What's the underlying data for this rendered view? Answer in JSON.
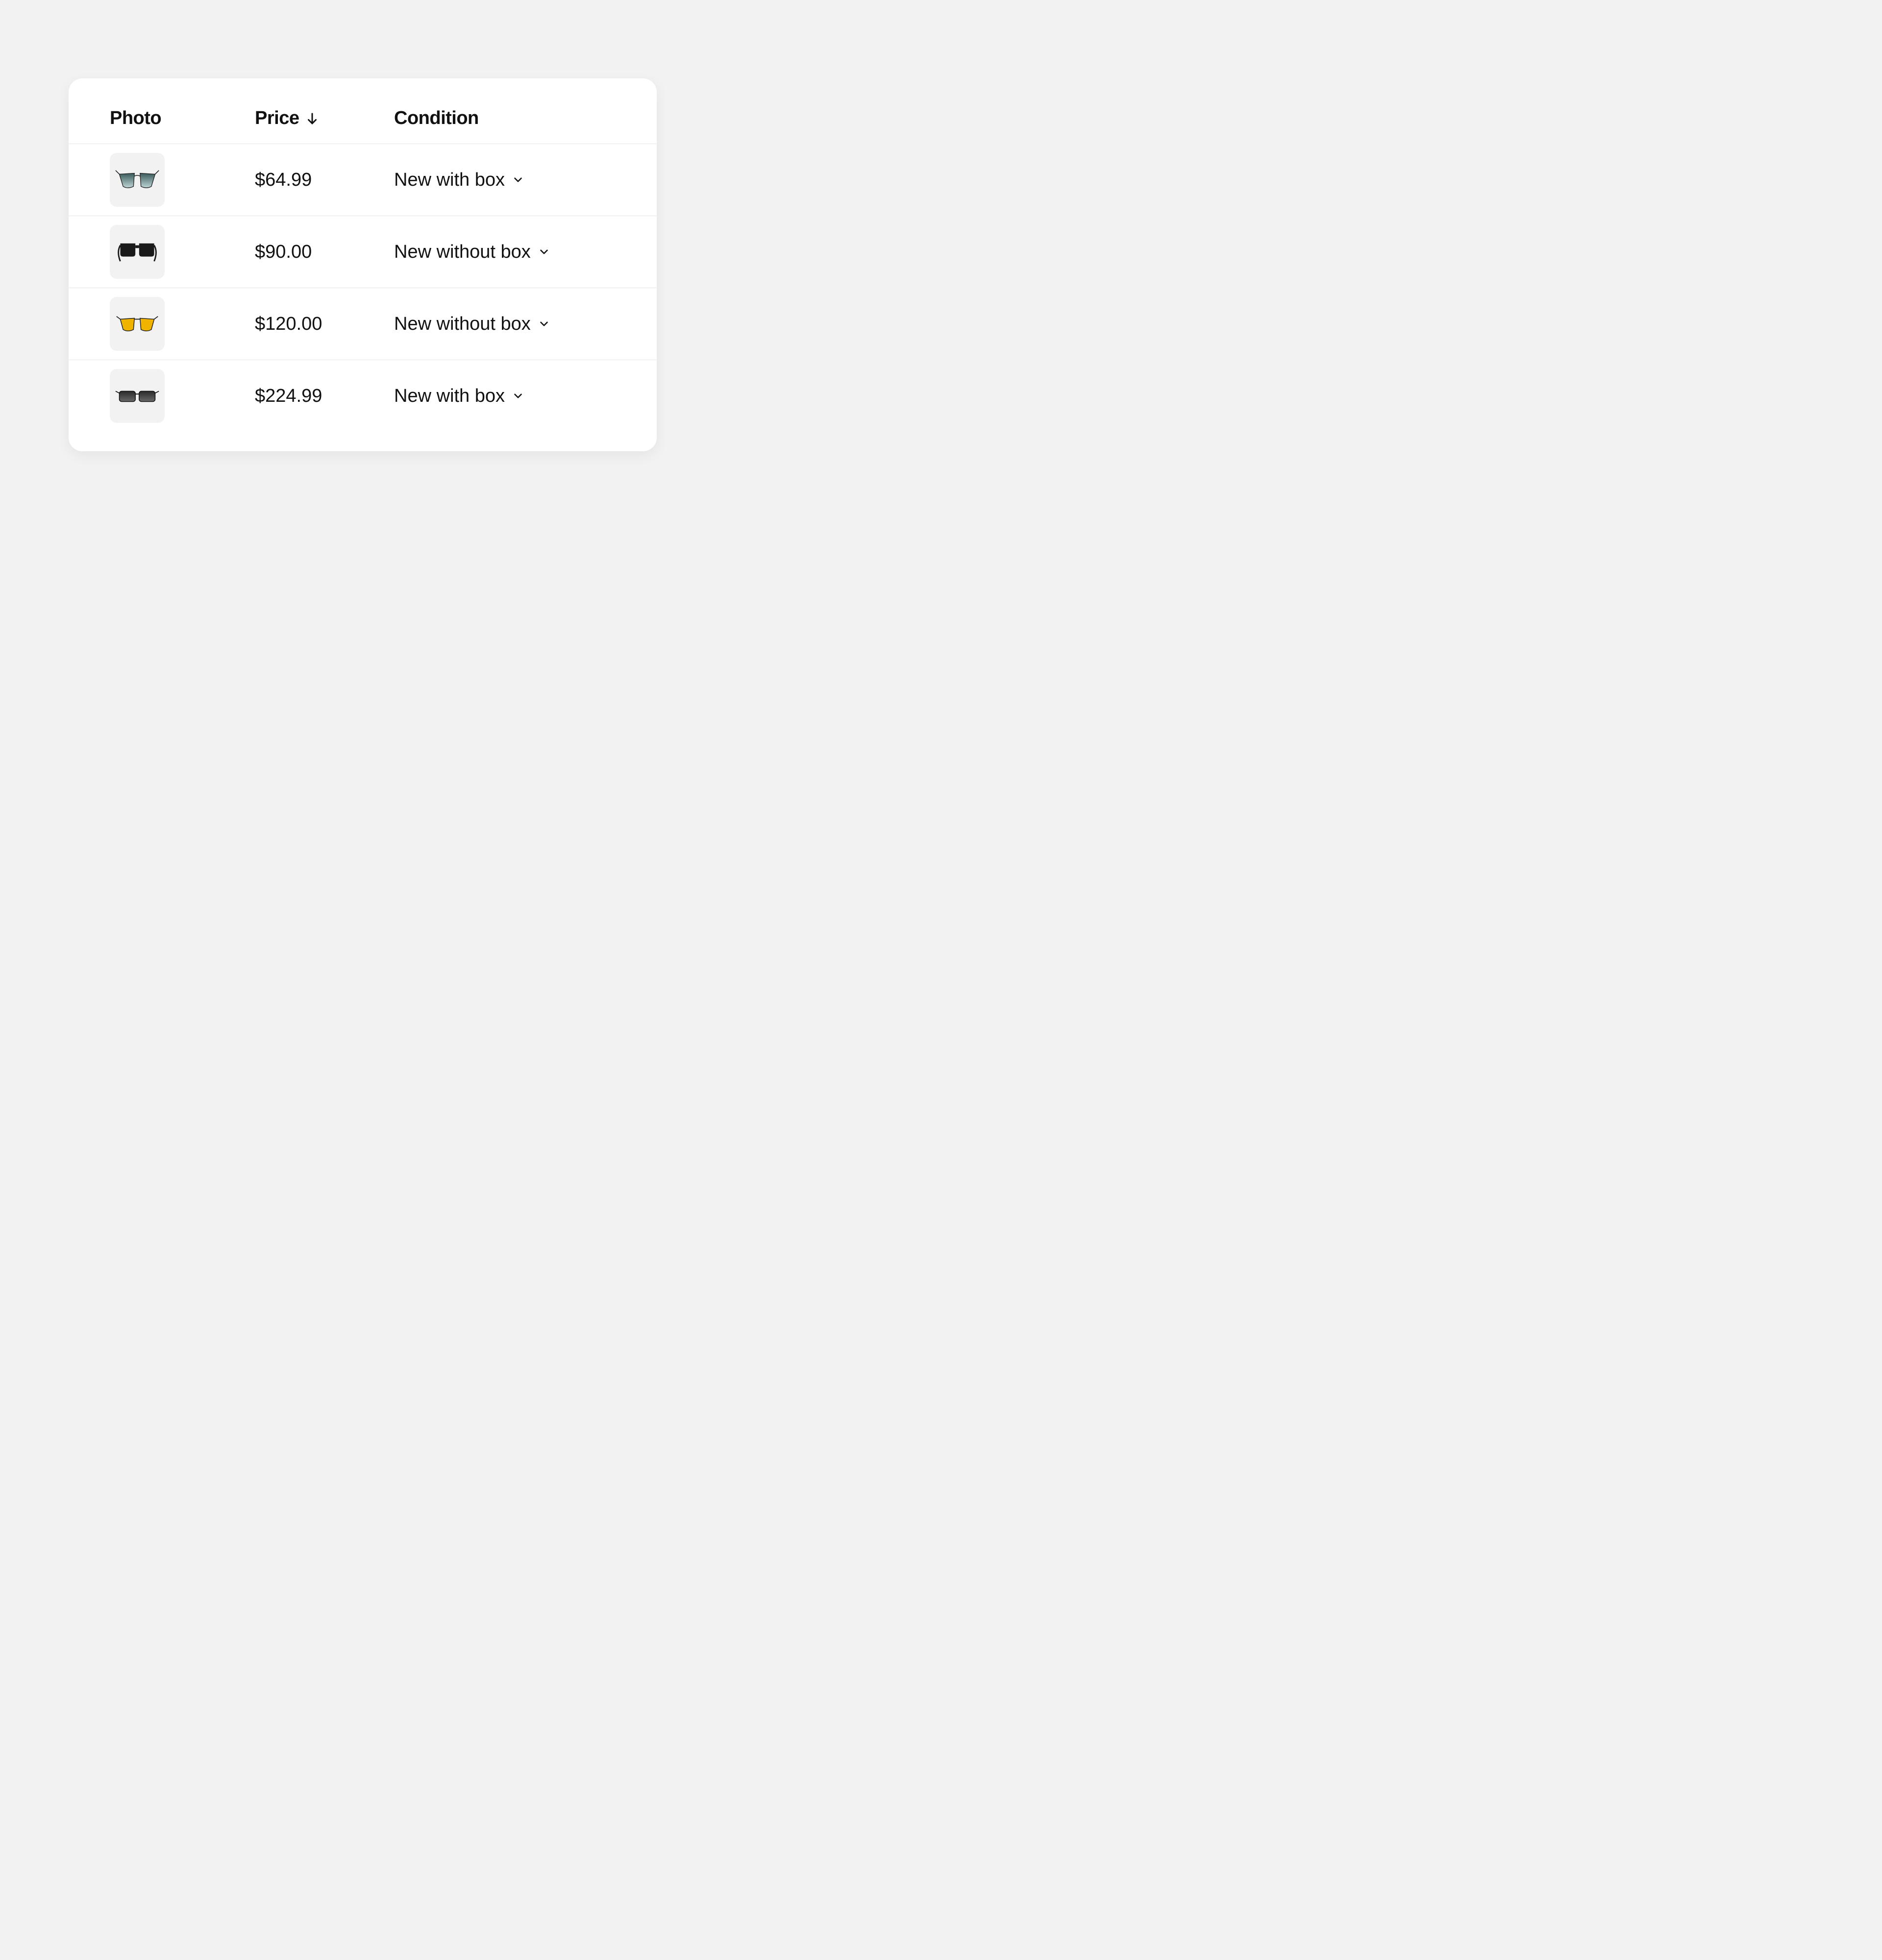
{
  "table": {
    "headers": {
      "photo": "Photo",
      "price": "Price",
      "condition": "Condition"
    },
    "sort": {
      "column": "price",
      "direction": "asc"
    },
    "rows": [
      {
        "photo_icon": "sunglasses-aviator-gradient",
        "price": "$64.99",
        "condition": "New with box"
      },
      {
        "photo_icon": "sunglasses-thick-black",
        "price": "$90.00",
        "condition": "New without box"
      },
      {
        "photo_icon": "sunglasses-yellow-lens",
        "price": "$120.00",
        "condition": "New without box"
      },
      {
        "photo_icon": "sunglasses-rectangular-black",
        "price": "$224.99",
        "condition": "New with box"
      }
    ]
  }
}
